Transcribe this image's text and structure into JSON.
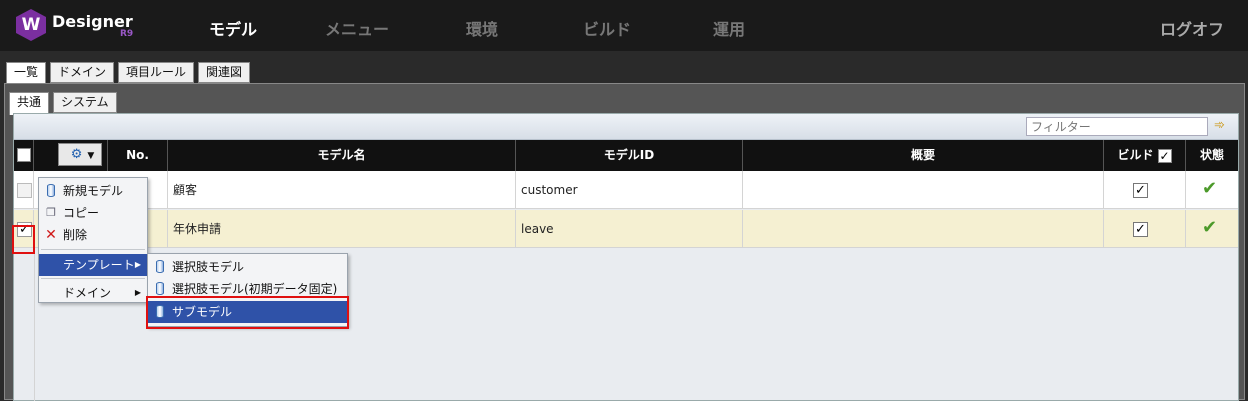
{
  "app": {
    "logo_mark": "W",
    "logo_name": "Designer",
    "logo_sub": "R9"
  },
  "nav": {
    "items": [
      "モデル",
      "メニュー",
      "環境",
      "ビルド",
      "運用"
    ],
    "active": "モデル",
    "logout": "ログオフ"
  },
  "tabs_main": [
    "一覧",
    "ドメイン",
    "項目ルール",
    "関連図"
  ],
  "tabs_sub": [
    "共通",
    "システム"
  ],
  "filter": {
    "placeholder": "フィルター"
  },
  "table": {
    "headers": {
      "no": "No.",
      "model_name": "モデル名",
      "model_id": "モデルID",
      "summary": "概要",
      "build": "ビルド",
      "status": "状態"
    },
    "rows": [
      {
        "name": "顧客",
        "id": "customer",
        "summary": "",
        "checked": false,
        "build": true,
        "status": "ok"
      },
      {
        "name": "年休申請",
        "id": "leave",
        "summary": "",
        "checked": true,
        "build": true,
        "status": "ok"
      }
    ]
  },
  "menu": {
    "items": [
      "新規モデル",
      "コピー",
      "削除"
    ],
    "template": "テンプレート",
    "domain": "ドメイン"
  },
  "submenu": {
    "items": [
      "選択肢モデル",
      "選択肢モデル(初期データ固定)",
      "サブモデル"
    ],
    "highlighted": "サブモデル"
  },
  "colors": {
    "accent": "#2f52a8",
    "brand": "#7b2fa0",
    "highlight_box": "#e01010",
    "selected_row": "#f5f0d2"
  },
  "icons": [
    "gear-icon",
    "caret-down-icon",
    "database-icon",
    "copy-icon",
    "delete-icon",
    "arrow-right-icon",
    "check-icon",
    "filter-go-icon"
  ]
}
